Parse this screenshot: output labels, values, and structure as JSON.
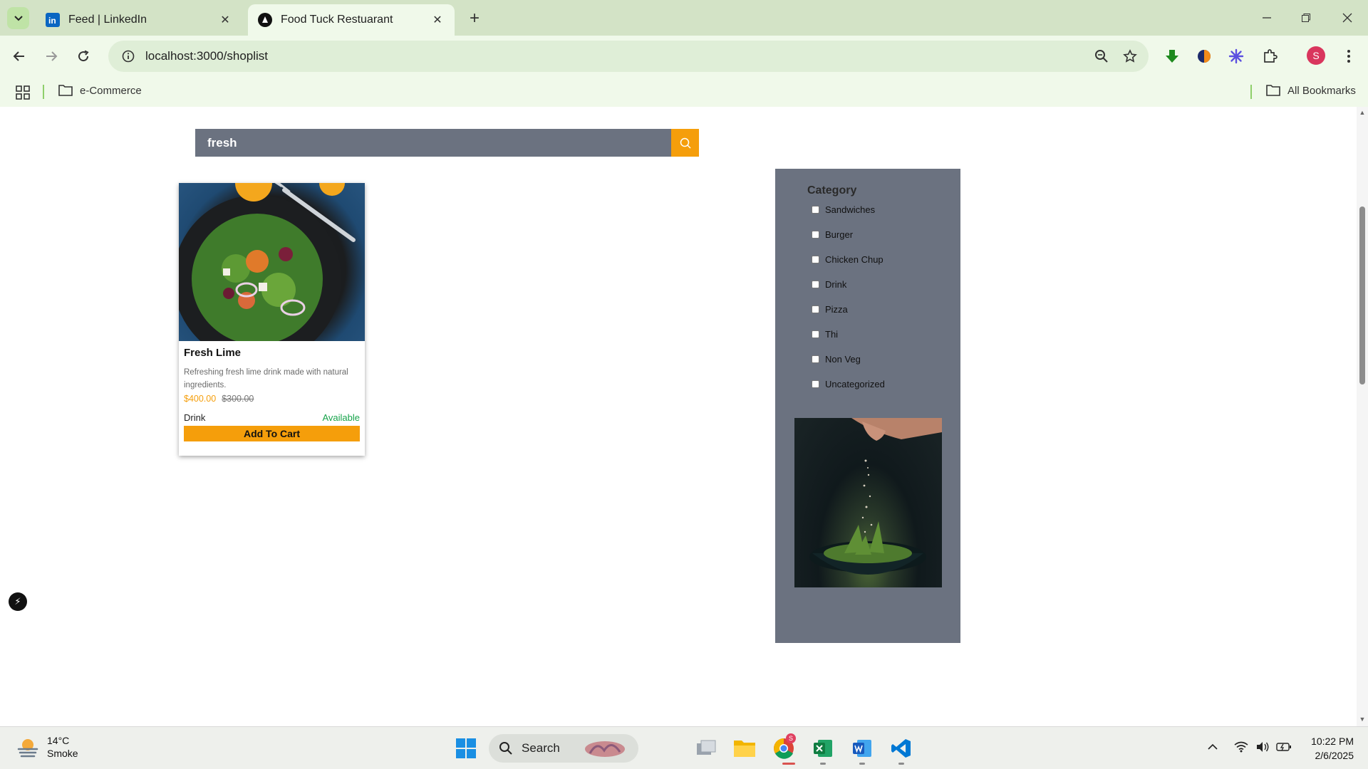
{
  "browser": {
    "tabs": [
      {
        "title": "Feed | LinkedIn",
        "favicon": "linkedin-icon",
        "active": false
      },
      {
        "title": "Food Tuck Restuarant",
        "favicon": "nextjs-icon",
        "active": true
      }
    ],
    "address": "localhost:3000/shoplist",
    "bookmarks": {
      "folder": "e-Commerce",
      "all_bookmarks": "All Bookmarks"
    },
    "profile_initial": "S"
  },
  "page": {
    "search": {
      "value": "fresh"
    },
    "product": {
      "name": "Fresh Lime",
      "description": "Refreshing fresh lime drink made with natural ingredients.",
      "price": "$400.00",
      "old_price": "$300.00",
      "category": "Drink",
      "status": "Available",
      "cta": "Add To Cart"
    },
    "sidebar": {
      "title": "Category",
      "categories": [
        "Sandwiches",
        "Burger",
        "Chicken Chup",
        "Drink",
        "Pizza",
        "Thi",
        "Non Veg",
        "Uncategorized"
      ]
    }
  },
  "taskbar": {
    "weather": {
      "temp": "14°C",
      "condition": "Smoke"
    },
    "search_label": "Search",
    "time": "10:22 PM",
    "date": "2/6/2025",
    "chrome_badge": "S"
  },
  "colors": {
    "accent": "#f59e0b",
    "sidebar_bg": "#6b7280",
    "available": "#16a34a",
    "browser_tab_bg": "#d3e3c6",
    "browser_toolbar_bg": "#f0f9ea"
  }
}
